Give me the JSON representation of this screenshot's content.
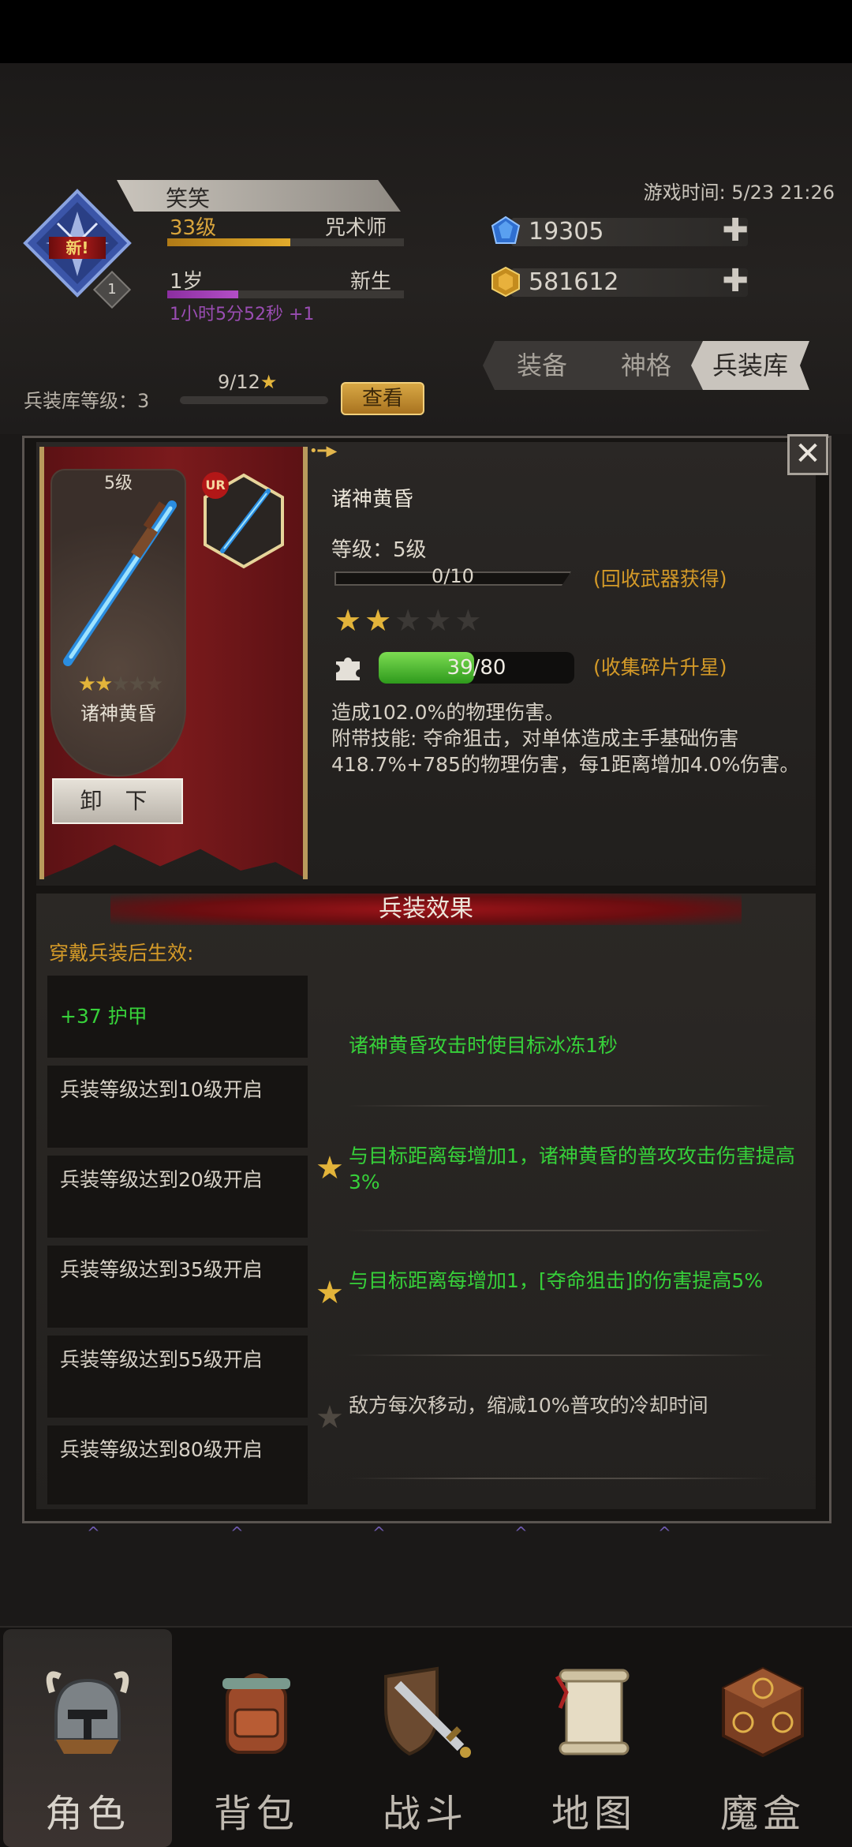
{
  "player": {
    "new_badge": "新!",
    "level_diamond": "1",
    "name": "笑笑",
    "level": "33级",
    "class": "咒术师",
    "age": "1岁",
    "stage": "新生",
    "time_extra": "1小时5分52秒 +1",
    "xp_progress": 0.52,
    "age_progress": 0.3
  },
  "game_time": "游戏时间: 5/23 21:26",
  "currencies": [
    {
      "icon": "blue-gem-icon",
      "value": "19305"
    },
    {
      "icon": "gold-gem-icon",
      "value": "581612"
    }
  ],
  "tabs": [
    {
      "label": "装备",
      "active": false
    },
    {
      "label": "神格",
      "active": false
    },
    {
      "label": "兵装库",
      "active": true
    }
  ],
  "armory": {
    "level_label": "兵装库等级：3",
    "progress": "9/12",
    "view_button": "查看"
  },
  "weapon": {
    "card_level": "5级",
    "card_name": "诸神黄昏",
    "card_stars": 2,
    "rarity": "UR",
    "unequip_button": "卸  下",
    "title": "诸神黄昏",
    "level": "等级：5级",
    "level_progress": "0/10",
    "level_hint": "(回收武器获得)",
    "stars_filled": 2,
    "stars_total": 5,
    "fragments": "39/80",
    "fragments_fraction": 0.4875,
    "fragment_hint": "(收集碎片升星)",
    "desc_line1": "造成102.0%的物理伤害。",
    "desc_line2": "附带技能: 夺命狙击，对单体造成主手基础伤害418.7%+785的物理伤害，每1距离增加4.0%伤害。"
  },
  "effects": {
    "title": "兵装效果",
    "wear_label": "穿戴兵装后生效:",
    "rows": [
      {
        "condition": "+37 护甲",
        "effect": "诸神黄昏攻击时使目标冰冻1秒"
      },
      {
        "condition": "兵装等级达到10级开启",
        "effect": "与目标距离每增加1，诸神黄昏的普攻攻击伤害提高3%"
      },
      {
        "condition": "兵装等级达到20级开启",
        "effect": "与目标距离每增加1，[夺命狙击]的伤害提高5%"
      },
      {
        "condition": "兵装等级达到35级开启",
        "effect": "敌方每次移动，缩减10%普攻的冷却时间"
      },
      {
        "condition": "兵装等级达到55级开启",
        "effect": ""
      },
      {
        "condition": "兵装等级达到80级开启",
        "effect": ""
      }
    ]
  },
  "nav": [
    {
      "label": "角色",
      "icon": "helmet-icon",
      "active": true
    },
    {
      "label": "背包",
      "icon": "backpack-icon",
      "active": false
    },
    {
      "label": "战斗",
      "icon": "sword-shield-icon",
      "active": false
    },
    {
      "label": "地图",
      "icon": "scroll-map-icon",
      "active": false
    },
    {
      "label": "魔盒",
      "icon": "magic-box-icon",
      "active": false
    }
  ]
}
